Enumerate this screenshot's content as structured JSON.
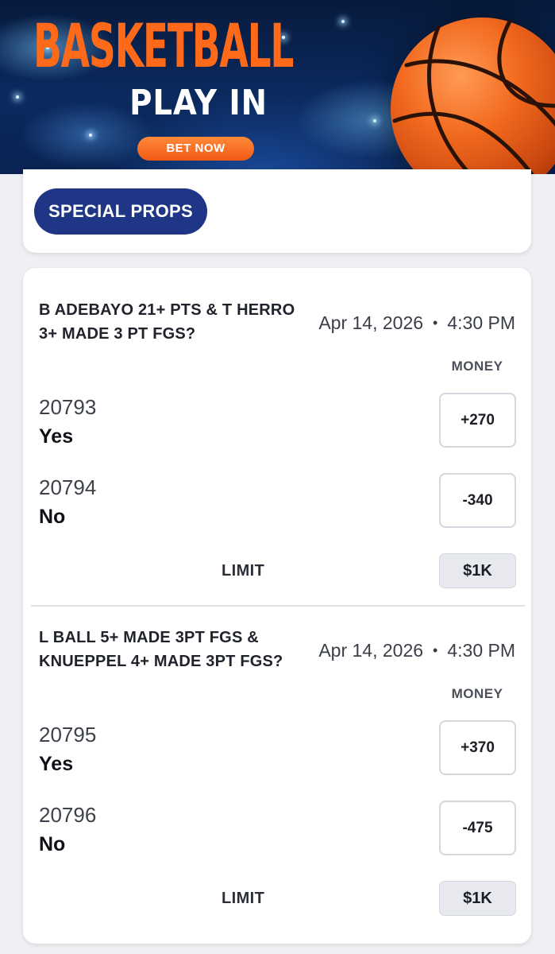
{
  "banner": {
    "title": "BASKETBALL",
    "subtitle": "PLAY IN",
    "cta": "BET NOW",
    "colors": {
      "title": "#ff6a1a",
      "background": "#0b2a5f",
      "cta": "#f25a14"
    }
  },
  "special_props_button": "SPECIAL PROPS",
  "bets": [
    {
      "title": "B ADEBAYO 21+ PTS & T HERRO 3+ MADE 3 PT FGS?",
      "date": "Apr 14, 2026",
      "separator": "•",
      "time": "4:30 PM",
      "money_header": "MONEY",
      "outcomes": [
        {
          "number": "20793",
          "label": "Yes",
          "odds": "+270"
        },
        {
          "number": "20794",
          "label": "No",
          "odds": "-340"
        }
      ],
      "limit_label": "LIMIT",
      "limit_value": "$1K"
    },
    {
      "title": "L BALL 5+ MADE 3PT FGS & KNUEPPEL 4+ MADE 3PT FGS?",
      "date": "Apr 14, 2026",
      "separator": "•",
      "time": "4:30 PM",
      "money_header": "MONEY",
      "outcomes": [
        {
          "number": "20795",
          "label": "Yes",
          "odds": "+370"
        },
        {
          "number": "20796",
          "label": "No",
          "odds": "-475"
        }
      ],
      "limit_label": "LIMIT",
      "limit_value": "$1K"
    }
  ],
  "colors": {
    "accent": "#1f3585",
    "page_background": "#eef0f3"
  }
}
